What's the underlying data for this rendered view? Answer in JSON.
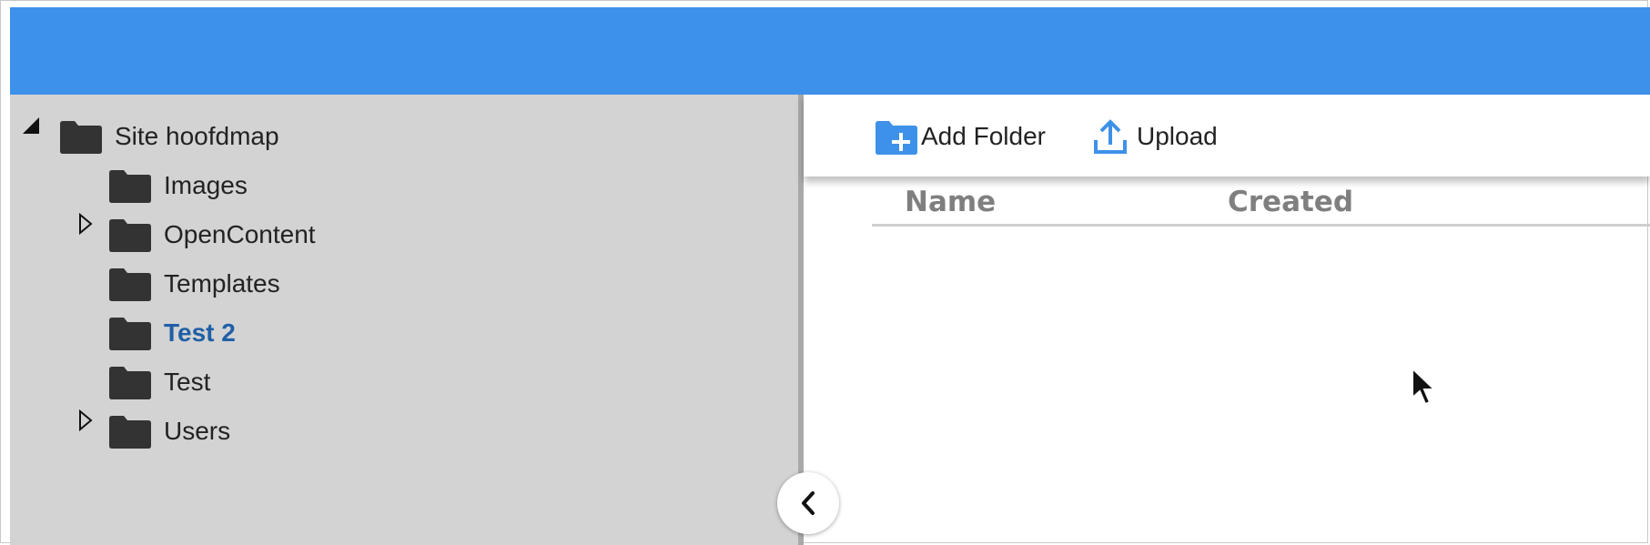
{
  "tree": {
    "root": {
      "label": "Site hoofdmap",
      "expanded": true
    },
    "children": [
      {
        "label": "Images",
        "has_children": false,
        "selected": false
      },
      {
        "label": "OpenContent",
        "has_children": true,
        "selected": false
      },
      {
        "label": "Templates",
        "has_children": false,
        "selected": false
      },
      {
        "label": "Test 2",
        "has_children": false,
        "selected": true
      },
      {
        "label": "Test",
        "has_children": false,
        "selected": false
      },
      {
        "label": "Users",
        "has_children": true,
        "selected": false
      }
    ]
  },
  "toolbar": {
    "add_folder_label": "Add Folder",
    "upload_label": "Upload"
  },
  "table": {
    "columns": [
      "Name",
      "Created"
    ]
  },
  "icons": {
    "folder": "folder-icon",
    "add_folder": "folder-plus-icon",
    "upload": "upload-icon",
    "collapse": "chevron-left-icon",
    "expanded": "triangle-expanded-icon",
    "collapsed": "triangle-collapsed-icon"
  },
  "colors": {
    "header": "#3d91e9",
    "sidebar": "#d3d3d3",
    "selected_text": "#1f5fa6",
    "accent_icon": "#3d91e9"
  }
}
